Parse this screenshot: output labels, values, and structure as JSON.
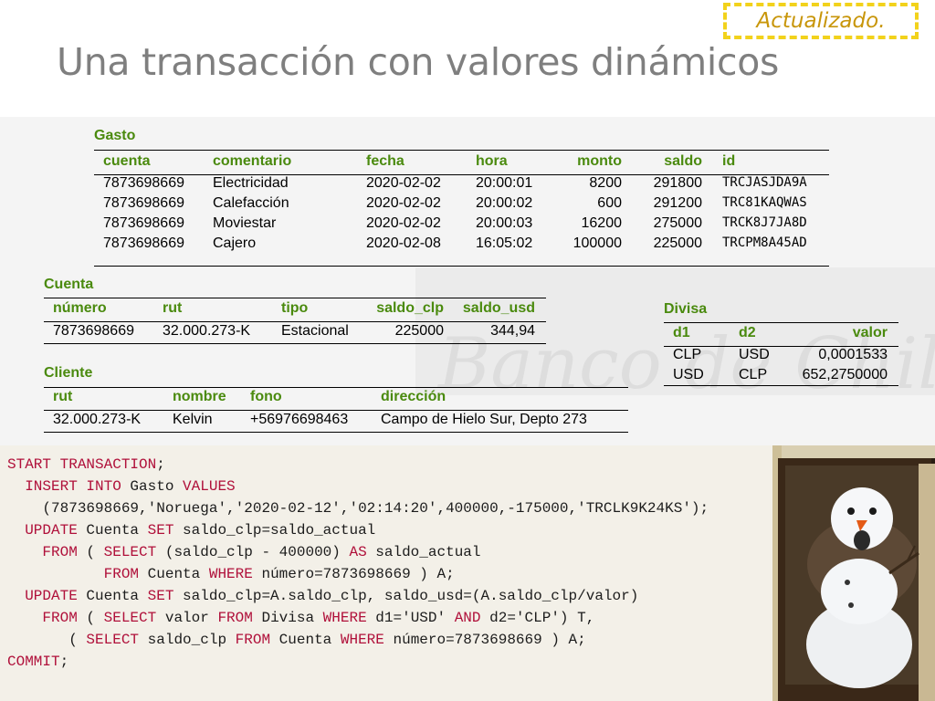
{
  "badge": "Actualizado.",
  "title": "Una transacción con valores dinámicos",
  "gasto": {
    "caption": "Gasto",
    "headers": [
      "cuenta",
      "comentario",
      "fecha",
      "hora",
      "monto",
      "saldo",
      "id"
    ],
    "rows": [
      [
        "7873698669",
        "Electricidad",
        "2020-02-02",
        "20:00:01",
        "8200",
        "291800",
        "TRCJASJDA9A"
      ],
      [
        "7873698669",
        "Calefacción",
        "2020-02-02",
        "20:00:02",
        "600",
        "291200",
        "TRC81KAQWAS"
      ],
      [
        "7873698669",
        "Moviestar",
        "2020-02-02",
        "20:00:03",
        "16200",
        "275000",
        "TRCK8J7JA8D"
      ],
      [
        "7873698669",
        "Cajero",
        "2020-02-08",
        "16:05:02",
        "100000",
        "225000",
        "TRCPM8A45AD"
      ]
    ]
  },
  "cuenta": {
    "caption": "Cuenta",
    "headers": [
      "número",
      "rut",
      "tipo",
      "saldo_clp",
      "saldo_usd"
    ],
    "rows": [
      [
        "7873698669",
        "32.000.273-K",
        "Estacional",
        "225000",
        "344,94"
      ]
    ]
  },
  "cliente": {
    "caption": "Cliente",
    "headers": [
      "rut",
      "nombre",
      "fono",
      "dirección"
    ],
    "rows": [
      [
        "32.000.273-K",
        "Kelvin",
        "+56976698463",
        "Campo de Hielo Sur, Depto 273"
      ]
    ]
  },
  "divisa": {
    "caption": "Divisa",
    "headers": [
      "d1",
      "d2",
      "valor"
    ],
    "rows": [
      [
        "CLP",
        "USD",
        "0,0001533"
      ],
      [
        "USD",
        "CLP",
        "652,2750000"
      ]
    ]
  },
  "code": [
    [
      [
        "k",
        "START TRANSACTION"
      ],
      [
        "t",
        ";"
      ]
    ],
    [
      [
        "t",
        "  "
      ],
      [
        "k",
        "INSERT INTO"
      ],
      [
        "t",
        " Gasto "
      ],
      [
        "k",
        "VALUES"
      ]
    ],
    [
      [
        "t",
        "    (7873698669,'Noruega','2020-02-12','02:14:20',400000,-175000,'TRCLK9K24KS');"
      ]
    ],
    [
      [
        "t",
        "  "
      ],
      [
        "k",
        "UPDATE"
      ],
      [
        "t",
        " Cuenta "
      ],
      [
        "k",
        "SET"
      ],
      [
        "t",
        " saldo_clp=saldo_actual"
      ]
    ],
    [
      [
        "t",
        "    "
      ],
      [
        "k",
        "FROM"
      ],
      [
        "t",
        " ( "
      ],
      [
        "k",
        "SELECT"
      ],
      [
        "t",
        " (saldo_clp - 400000) "
      ],
      [
        "k",
        "AS"
      ],
      [
        "t",
        " saldo_actual"
      ]
    ],
    [
      [
        "t",
        "           "
      ],
      [
        "k",
        "FROM"
      ],
      [
        "t",
        " Cuenta "
      ],
      [
        "k",
        "WHERE"
      ],
      [
        "t",
        " número=7873698669 ) A;"
      ]
    ],
    [
      [
        "t",
        "  "
      ],
      [
        "k",
        "UPDATE"
      ],
      [
        "t",
        " Cuenta "
      ],
      [
        "k",
        "SET"
      ],
      [
        "t",
        " saldo_clp=A.saldo_clp, saldo_usd=(A.saldo_clp/valor)"
      ]
    ],
    [
      [
        "t",
        "    "
      ],
      [
        "k",
        "FROM"
      ],
      [
        "t",
        " ( "
      ],
      [
        "k",
        "SELECT"
      ],
      [
        "t",
        " valor "
      ],
      [
        "k",
        "FROM"
      ],
      [
        "t",
        " Divisa "
      ],
      [
        "k",
        "WHERE"
      ],
      [
        "t",
        " d1='USD' "
      ],
      [
        "k",
        "AND"
      ],
      [
        "t",
        " d2='CLP') T,"
      ]
    ],
    [
      [
        "t",
        "       ( "
      ],
      [
        "k",
        "SELECT"
      ],
      [
        "t",
        " saldo_clp "
      ],
      [
        "k",
        "FROM"
      ],
      [
        "t",
        " Cuenta "
      ],
      [
        "k",
        "WHERE"
      ],
      [
        "t",
        " número=7873698669 ) A;"
      ]
    ],
    [
      [
        "k",
        "COMMIT"
      ],
      [
        "t",
        ";"
      ]
    ]
  ],
  "colors": {
    "header_green": "#4a8a0e",
    "keyword": "#b0103a",
    "title_gray": "#7f7f7f",
    "badge_border": "#f2d21b"
  }
}
